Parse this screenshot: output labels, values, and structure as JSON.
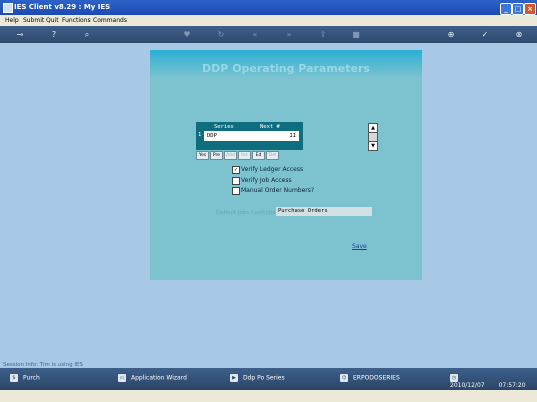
{
  "window": {
    "title": "IES Client v8.29 : My IES"
  },
  "menu": [
    "Help",
    "Submit",
    "Quit",
    "Functions",
    "Commands"
  ],
  "toolbar": {
    "icons": [
      "key-icon",
      "help-icon",
      "search-icon",
      "heart-icon",
      "refresh-icon",
      "rewind-icon",
      "fast-forward-icon",
      "export-icon",
      "stop-icon",
      "add-icon",
      "check-icon",
      "close-icon"
    ]
  },
  "panel": {
    "title": "DDP Operating Parameters"
  },
  "grid": {
    "headers": [
      "Series",
      "Next #"
    ],
    "rows": [
      {
        "num": "1",
        "series": "DDP",
        "next": "11"
      }
    ],
    "buttons": [
      "Yes",
      "Pre",
      "Add",
      "Ins",
      "Ed",
      "Del"
    ]
  },
  "options": [
    {
      "label": "Verify Ledger Access",
      "checked": true
    },
    {
      "label": "Verify Job Access",
      "checked": false
    },
    {
      "label": "Manual Order Numbers?",
      "checked": false
    }
  ],
  "field": {
    "label": "Default Jobs Costtype",
    "value": "Purchase Orders"
  },
  "save_label": "Save",
  "status_text": "Session Info: Tim is using IES",
  "taskbar": [
    {
      "label": "Purch",
      "icon": "purch-icon"
    },
    {
      "label": "Application Wizard",
      "icon": "wizard-icon"
    },
    {
      "label": "Ddp Po Series",
      "icon": "series-icon"
    },
    {
      "label": "ERPODOSERIES",
      "icon": "code-icon"
    },
    {
      "date": "2010/12/07",
      "time": "07:57:20",
      "icon": "clock-icon"
    }
  ]
}
